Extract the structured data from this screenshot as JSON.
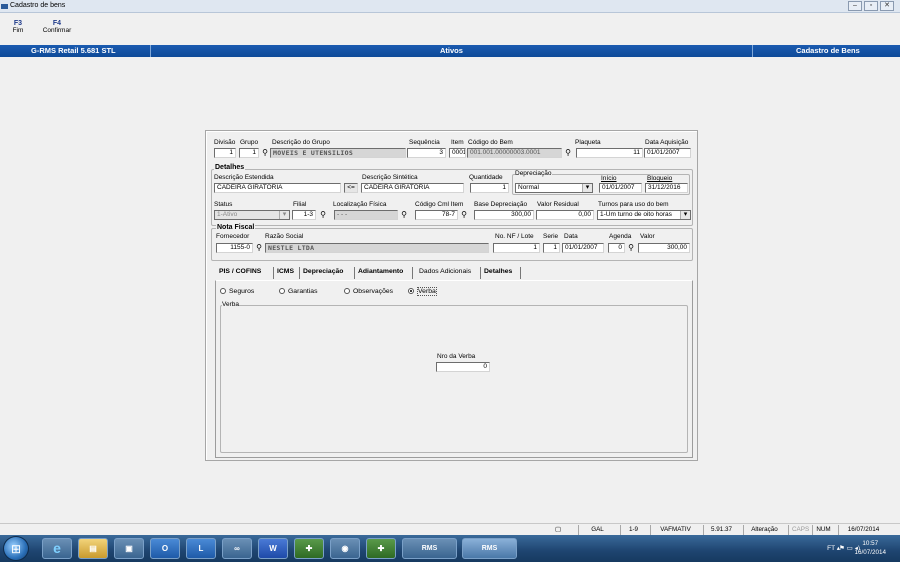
{
  "window": {
    "title": "Cadastro de bens"
  },
  "fkeys": [
    {
      "key": "F3",
      "label": "Fim"
    },
    {
      "key": "F4",
      "label": "Confirmar"
    }
  ],
  "header": {
    "left": "G-RMS Retail 5.681 STL",
    "center": "Ativos",
    "right": "Cadastro de Bens"
  },
  "form": {
    "divisao": {
      "label": "Divisão",
      "value": "1"
    },
    "grupo": {
      "label": "Grupo",
      "value": "1"
    },
    "desc_grupo": {
      "label": "Descrição do Grupo",
      "value": "MOVEIS E UTENSILIOS"
    },
    "sequencia": {
      "label": "Sequência",
      "value": "3"
    },
    "item": {
      "label": "Item",
      "value": "0001"
    },
    "codigo_bem": {
      "label": "Código do Bem",
      "value": "001.001.00000003.0001"
    },
    "plaqueta": {
      "label": "Plaqueta",
      "value": "11"
    },
    "data_aquisicao": {
      "label": "Data Aquisição",
      "value": "01/01/2007"
    },
    "detalhes_title": "Detalhes",
    "desc_estendida": {
      "label": "Descrição Estendida",
      "value": "CADEIRA GIRATORIA"
    },
    "copy_btn": "<=",
    "desc_sintetica": {
      "label": "Descrição Sintética",
      "value": "CADEIRA GIRATORIA"
    },
    "quantidade": {
      "label": "Quantidade",
      "value": "1"
    },
    "depreciacao": {
      "label": "Depreciação",
      "value": "Normal"
    },
    "inicio": {
      "label": "Início",
      "value": "01/01/2007"
    },
    "bloqueio": {
      "label": "Bloqueio",
      "value": "31/12/2016"
    },
    "status": {
      "label": "Status",
      "value": "1-Ativo"
    },
    "filial": {
      "label": "Filial",
      "value": "1-3"
    },
    "localizacao": {
      "label": "Localização Física",
      "value": "- - -"
    },
    "codigo_cml": {
      "label": "Código Cml Item",
      "value": "78-7"
    },
    "base_dep": {
      "label": "Base Depreciação",
      "value": "300,00"
    },
    "valor_residual": {
      "label": "Valor Residual",
      "value": "0,00"
    },
    "turnos": {
      "label": "Turnos para uso do bem",
      "value": "1-Um turno de oito horas"
    },
    "nf_title": "Nota Fiscal",
    "fornecedor": {
      "label": "Fornecedor",
      "value": "1155-0"
    },
    "razao": {
      "label": "Razão Social",
      "value": "NESTLE LTDA"
    },
    "nf_lote": {
      "label": "No. NF / Lote",
      "value": "1"
    },
    "serie": {
      "label": "Serie",
      "value": "1"
    },
    "nf_data": {
      "label": "Data",
      "value": "01/01/2007"
    },
    "agenda": {
      "label": "Agenda",
      "value": "0"
    },
    "valor": {
      "label": "Valor",
      "value": "300,00"
    }
  },
  "tabs": [
    "PIS / COFINS",
    "ICMS",
    "Depreciação",
    "Adiantamento",
    "Dados Adicionais",
    "Detalhes"
  ],
  "radios": [
    "Seguros",
    "Garantias",
    "Observações",
    "Verba"
  ],
  "verba": {
    "group": "Verba",
    "nro_label": "Nro da Verba",
    "nro_value": "0"
  },
  "status": [
    "GAL",
    "1-9",
    "VAFMATIV",
    "5.91.37",
    "Alteração",
    "CAPS",
    "NUM",
    "16/07/2014"
  ],
  "taskbar": {
    "apps": [
      "IE",
      "Explorer",
      "Media",
      "Outlook",
      "Lync",
      "Meet",
      "Word",
      "App",
      "Lync2",
      "App2",
      "RMS",
      "RMS"
    ],
    "tray": "FT ▴",
    "time": "10:57",
    "date": "16/07/2014"
  }
}
